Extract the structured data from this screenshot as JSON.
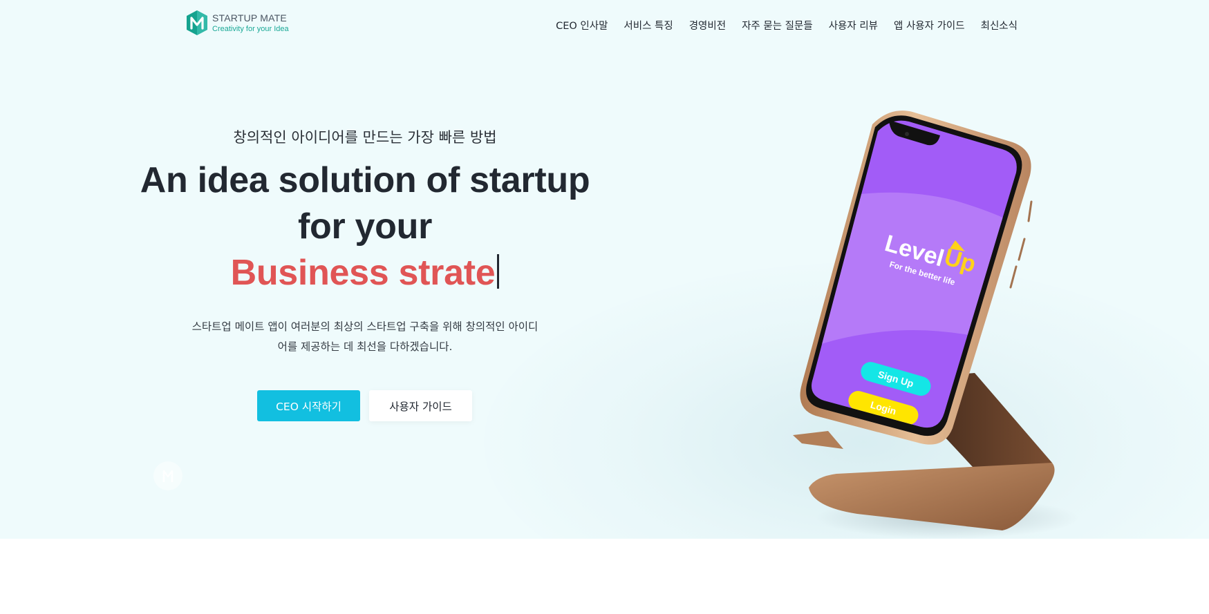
{
  "brand": {
    "title": "STARTUP MATE",
    "tagline": "Creativity for your Idea",
    "logo_letter": "M",
    "colors": {
      "teal": "#15a38f",
      "teal_light": "#3ec2b1"
    }
  },
  "nav": {
    "items": [
      {
        "label": "CEO 인사말"
      },
      {
        "label": "서비스 특징"
      },
      {
        "label": "경영비전"
      },
      {
        "label": "자주 묻는 질문들"
      },
      {
        "label": "사용자 리뷰"
      },
      {
        "label": "앱 사용자 가이드"
      },
      {
        "label": "최신소식"
      }
    ]
  },
  "hero": {
    "subtitle": "창의적인 아이디어를 만드는 가장 빠른 방법",
    "headline_line1": "An idea solution of startup",
    "headline_line2": "for your",
    "headline_typed": "Business strate",
    "description_line1": "스타트업 메이트 앱이 여러분의 최상의 스타트업 구축을 위해 창의적인 아이디",
    "description_line2": "어를 제공하는 데 최선을 다하겠습니다.",
    "buttons": {
      "start_label": "CEO 시작하기",
      "guide_label": "사용자 가이드"
    },
    "colors": {
      "background": "#effbfc",
      "accent_text": "#e05555",
      "primary_button": "#12bfe0",
      "heading": "#222831"
    }
  },
  "phone": {
    "app_name_part1": "Level",
    "app_name_part2": "Up",
    "app_slogan": "For the better life",
    "signup_label": "Sign Up",
    "login_label": "Login",
    "colors": {
      "screen": "#a25cf7",
      "screen_band": "#b57af8",
      "signup_button": "#14e6e6",
      "login_button": "#ffe500",
      "frame": "#c99a72",
      "stand": "#b8835c"
    }
  }
}
